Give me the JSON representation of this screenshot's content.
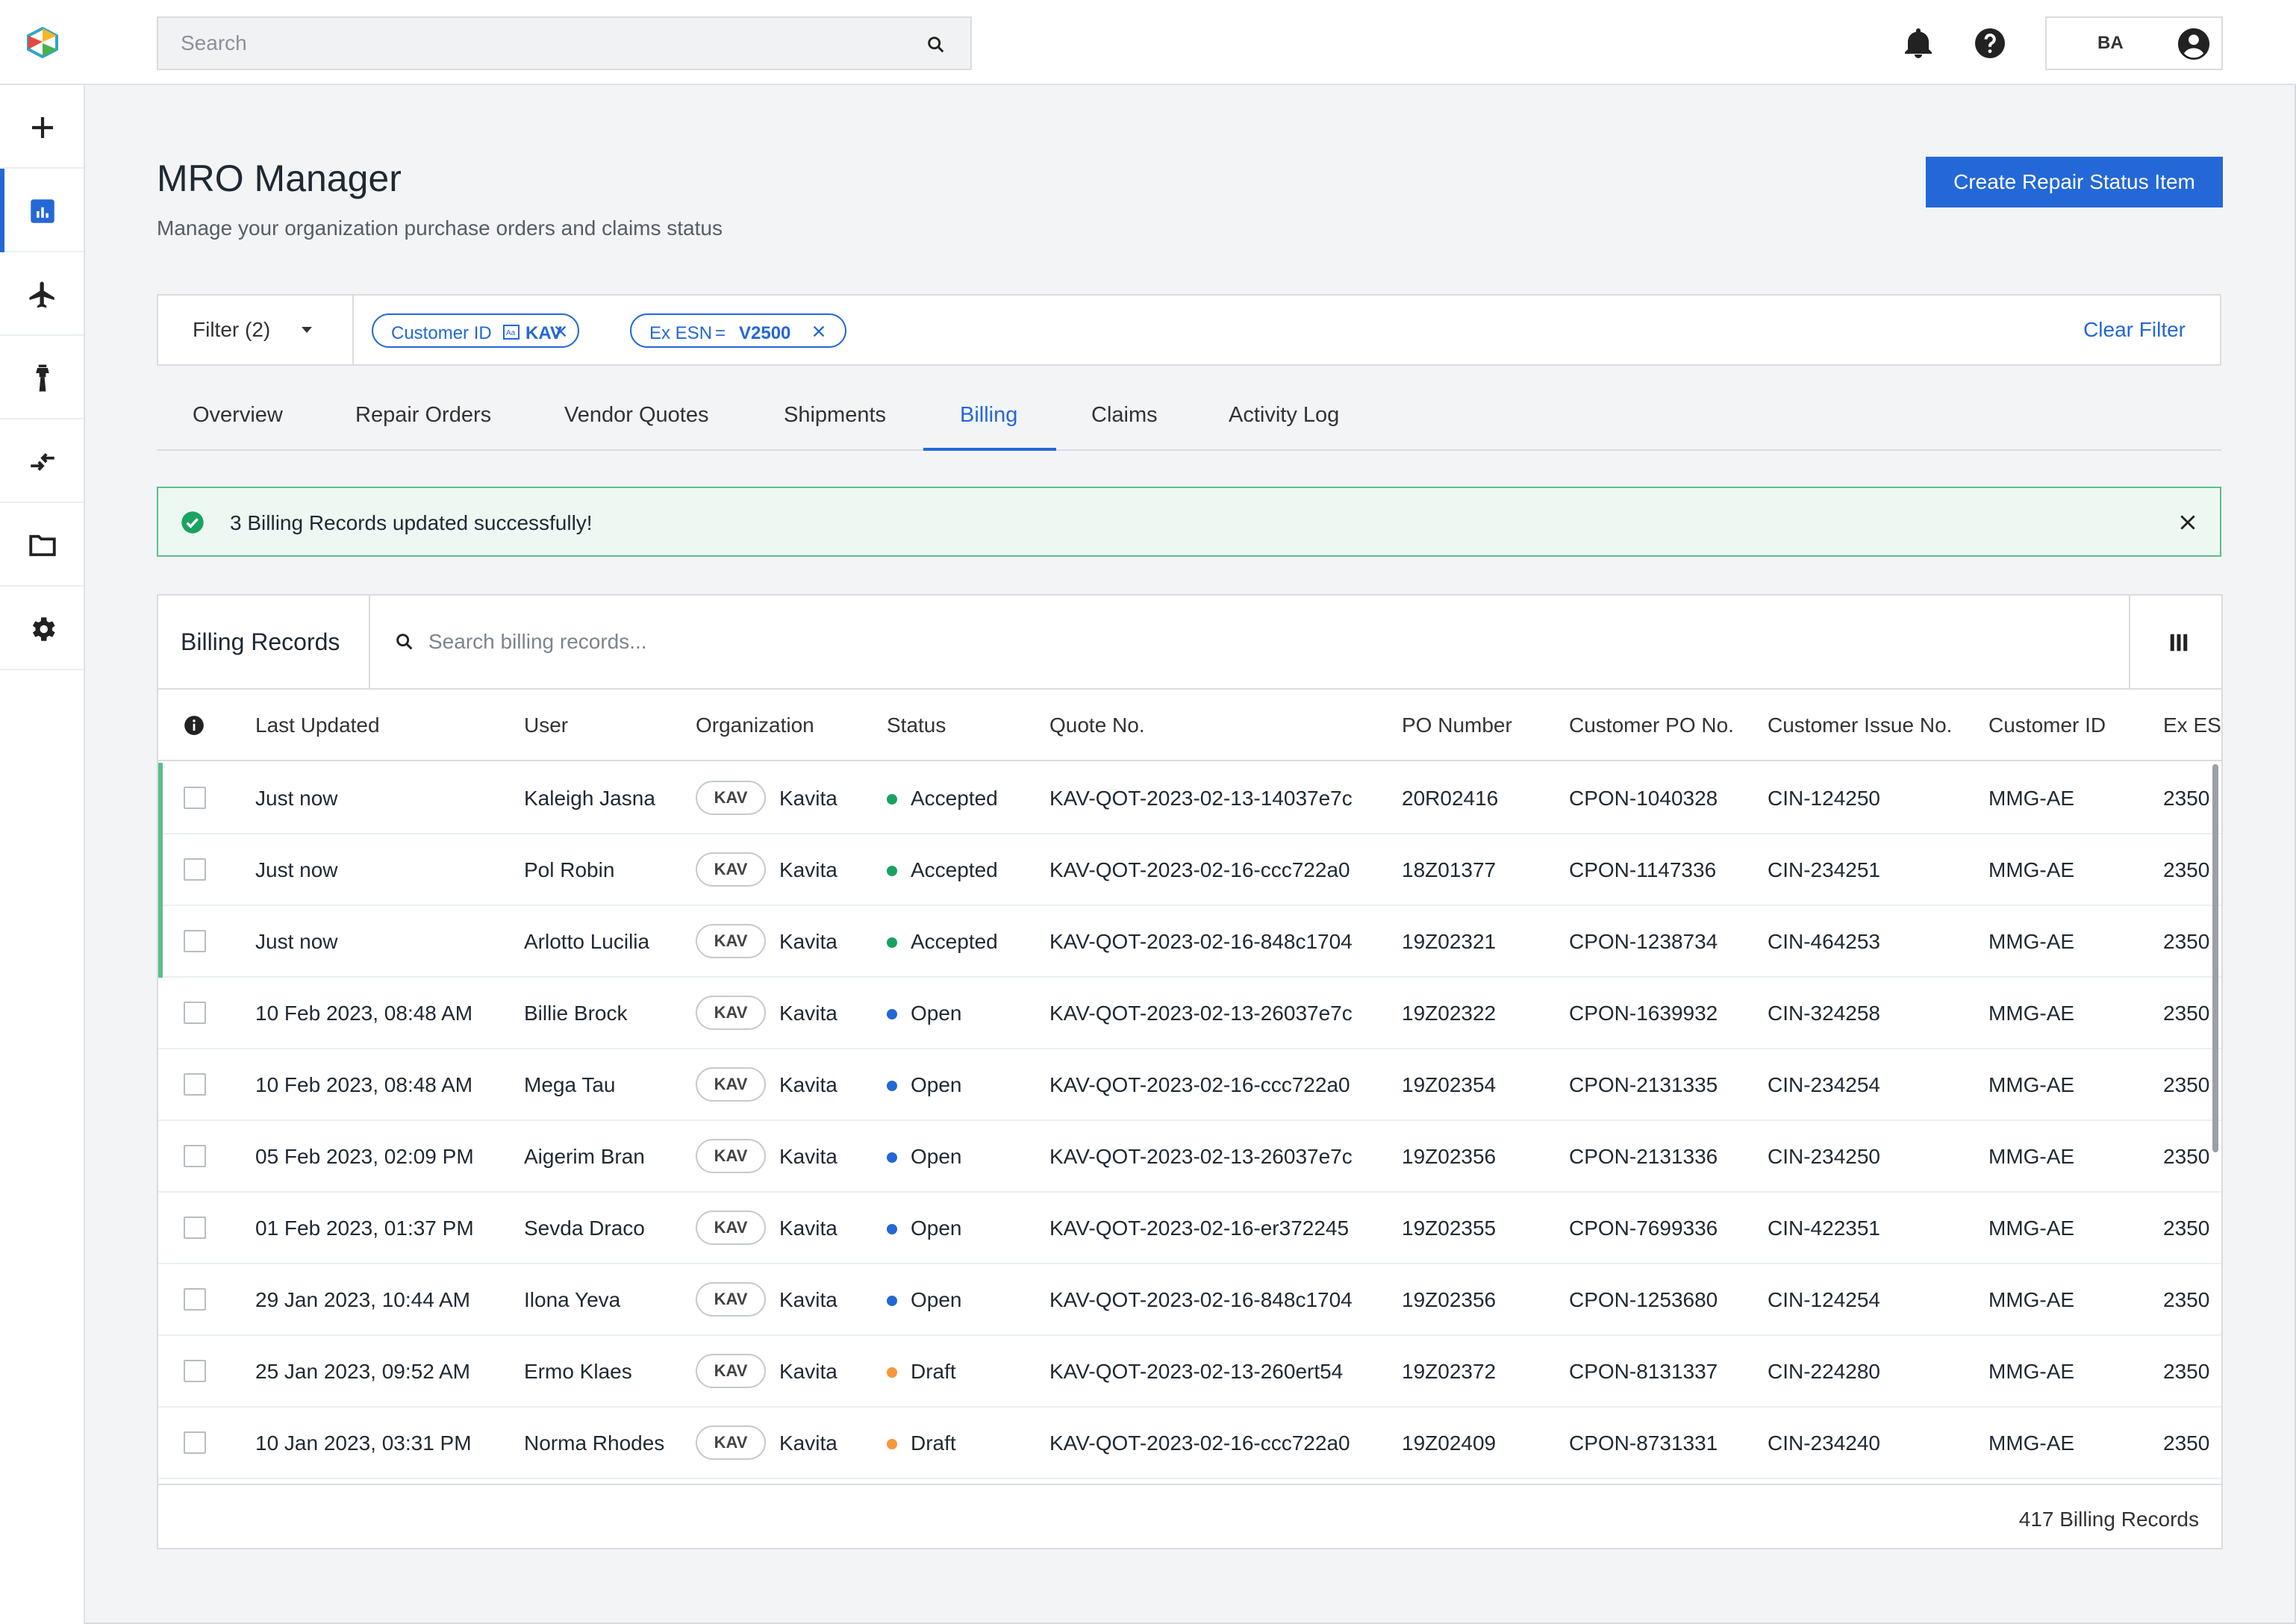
{
  "topbar": {
    "search_placeholder": "Search",
    "user_initials": "BA",
    "icons": [
      "logo",
      "search-icon",
      "bell-icon",
      "help-icon",
      "account-icon"
    ]
  },
  "sidenav": {
    "items": [
      {
        "name": "add",
        "icon": "plus-icon"
      },
      {
        "name": "dashboard",
        "icon": "chart-icon",
        "active": true
      },
      {
        "name": "flights",
        "icon": "airplane-icon"
      },
      {
        "name": "tower",
        "icon": "control-tower-icon"
      },
      {
        "name": "transfer",
        "icon": "swap-icon"
      },
      {
        "name": "files",
        "icon": "folder-icon"
      },
      {
        "name": "settings",
        "icon": "gear-icon"
      }
    ]
  },
  "header": {
    "title": "MRO Manager",
    "subtitle": "Manage your organization purchase orders and claims status",
    "primary_action": "Create Repair Status Item"
  },
  "filters": {
    "dropdown_label": "Filter (2)",
    "chips": [
      {
        "label": "Customer ID",
        "operator_icon": "contains-icon",
        "value": "KAV"
      },
      {
        "label": "Ex ESN",
        "operator": "=",
        "value": "V2500"
      }
    ],
    "clear_label": "Clear Filter"
  },
  "tabs": [
    {
      "label": "Overview"
    },
    {
      "label": "Repair Orders"
    },
    {
      "label": "Vendor Quotes"
    },
    {
      "label": "Shipments"
    },
    {
      "label": "Billing",
      "active": true
    },
    {
      "label": "Claims"
    },
    {
      "label": "Activity Log"
    }
  ],
  "alert": {
    "message": "3 Billing Records updated successfully!",
    "type": "success"
  },
  "table": {
    "title": "Billing Records",
    "search_placeholder": "Search billing records...",
    "columns": [
      "Last Updated",
      "User",
      "Organization",
      "Status",
      "Quote No.",
      "PO Number",
      "Customer PO No.",
      "Customer Issue No.",
      "Customer ID",
      "Ex ESN"
    ],
    "status_colors": {
      "Accepted": "#1aa260",
      "Open": "#2368d6",
      "Draft": "#f5973a"
    },
    "rows": [
      {
        "updated": "Just now",
        "user": "Kaleigh Jasna",
        "org_tag": "KAV",
        "org": "Kavita",
        "status": "Accepted",
        "quote": "KAV-QOT-2023-02-13-14037e7c",
        "po": "20R02416",
        "cust_po": "CPON-1040328",
        "issue": "CIN-124250",
        "cust_id": "MMG-AE",
        "esn": "2350",
        "new": true
      },
      {
        "updated": "Just now",
        "user": "Pol Robin",
        "org_tag": "KAV",
        "org": "Kavita",
        "status": "Accepted",
        "quote": "KAV-QOT-2023-02-16-ccc722a0",
        "po": "18Z01377",
        "cust_po": "CPON-1147336",
        "issue": "CIN-234251",
        "cust_id": "MMG-AE",
        "esn": "2350",
        "new": true
      },
      {
        "updated": "Just now",
        "user": "Arlotto Lucilia",
        "org_tag": "KAV",
        "org": "Kavita",
        "status": "Accepted",
        "quote": "KAV-QOT-2023-02-16-848c1704",
        "po": "19Z02321",
        "cust_po": "CPON-1238734",
        "issue": "CIN-464253",
        "cust_id": "MMG-AE",
        "esn": "2350",
        "new": true
      },
      {
        "updated": "10 Feb 2023, 08:48 AM",
        "user": "Billie Brock",
        "org_tag": "KAV",
        "org": "Kavita",
        "status": "Open",
        "quote": "KAV-QOT-2023-02-13-26037e7c",
        "po": "19Z02322",
        "cust_po": "CPON-1639932",
        "issue": "CIN-324258",
        "cust_id": "MMG-AE",
        "esn": "2350",
        "new": false
      },
      {
        "updated": "10 Feb 2023, 08:48 AM",
        "user": "Mega Tau",
        "org_tag": "KAV",
        "org": "Kavita",
        "status": "Open",
        "quote": "KAV-QOT-2023-02-16-ccc722a0",
        "po": "19Z02354",
        "cust_po": "CPON-2131335",
        "issue": "CIN-234254",
        "cust_id": "MMG-AE",
        "esn": "2350",
        "new": false
      },
      {
        "updated": "05 Feb 2023, 02:09 PM",
        "user": "Aigerim Bran",
        "org_tag": "KAV",
        "org": "Kavita",
        "status": "Open",
        "quote": "KAV-QOT-2023-02-13-26037e7c",
        "po": "19Z02356",
        "cust_po": "CPON-2131336",
        "issue": "CIN-234250",
        "cust_id": "MMG-AE",
        "esn": "2350",
        "new": false
      },
      {
        "updated": "01 Feb 2023, 01:37 PM",
        "user": "Sevda Draco",
        "org_tag": "KAV",
        "org": "Kavita",
        "status": "Open",
        "quote": "KAV-QOT-2023-02-16-er372245",
        "po": "19Z02355",
        "cust_po": "CPON-7699336",
        "issue": "CIN-422351",
        "cust_id": "MMG-AE",
        "esn": "2350",
        "new": false
      },
      {
        "updated": "29 Jan 2023, 10:44 AM",
        "user": "Ilona Yeva",
        "org_tag": "KAV",
        "org": "Kavita",
        "status": "Open",
        "quote": "KAV-QOT-2023-02-16-848c1704",
        "po": "19Z02356",
        "cust_po": "CPON-1253680",
        "issue": "CIN-124254",
        "cust_id": "MMG-AE",
        "esn": "2350",
        "new": false
      },
      {
        "updated": "25 Jan 2023, 09:52 AM",
        "user": "Ermo Klaes",
        "org_tag": "KAV",
        "org": "Kavita",
        "status": "Draft",
        "quote": "KAV-QOT-2023-02-13-260ert54",
        "po": "19Z02372",
        "cust_po": "CPON-8131337",
        "issue": "CIN-224280",
        "cust_id": "MMG-AE",
        "esn": "2350",
        "new": false
      },
      {
        "updated": "10 Jan 2023, 03:31 PM",
        "user": "Norma Rhodes",
        "org_tag": "KAV",
        "org": "Kavita",
        "status": "Draft",
        "quote": "KAV-QOT-2023-02-16-ccc722a0",
        "po": "19Z02409",
        "cust_po": "CPON-8731331",
        "issue": "CIN-234240",
        "cust_id": "MMG-AE",
        "esn": "2350",
        "new": false
      }
    ],
    "footer": "417 Billing Records"
  },
  "colors": {
    "accent": "#2368d6",
    "success": "#1aa260",
    "success_border": "#5bbf8a",
    "alert_bg": "#eef8f3"
  }
}
